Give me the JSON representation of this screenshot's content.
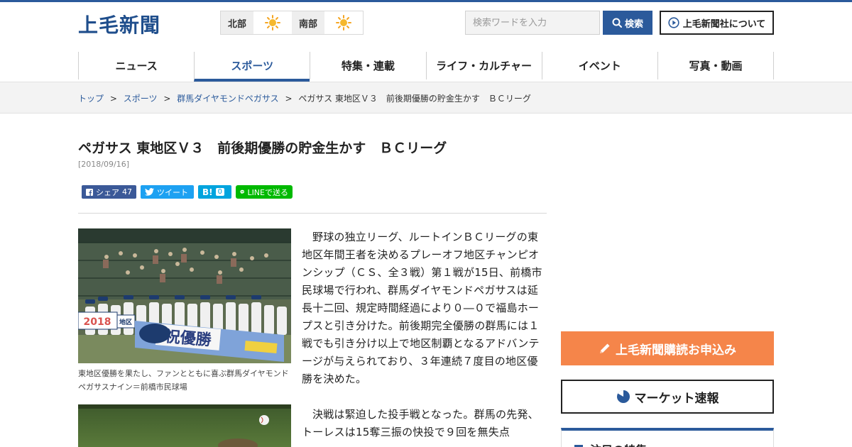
{
  "header": {
    "logo_text": "上毛新聞",
    "weather": [
      {
        "region": "北部",
        "icon": "sun-icon"
      },
      {
        "region": "南部",
        "icon": "sun-icon"
      }
    ],
    "search_placeholder": "検索ワードを入力",
    "search_label": "検索",
    "about_label": "上毛新聞社について"
  },
  "nav": {
    "items": [
      "ニュース",
      "スポーツ",
      "特集・連載",
      "ライフ・カルチャー",
      "イベント",
      "写真・動画"
    ],
    "active_index": 1
  },
  "breadcrumb": {
    "items": [
      "トップ",
      "スポーツ",
      "群馬ダイヤモンドペガサス"
    ],
    "current": "ペガサス 東地区Ｖ３　前後期優勝の貯金生かす　ＢＣリーグ",
    "separator": ">"
  },
  "article": {
    "title": "ペガサス 東地区Ｖ３　前後期優勝の貯金生かす　ＢＣリーグ",
    "date": "[2018/09/16]",
    "share": {
      "facebook_label": "シェア",
      "facebook_count": "47",
      "twitter_label": "ツイート",
      "hatena_label": "B!",
      "hatena_count": "0",
      "line_label": "LINEで送る"
    },
    "photo1_caption": "東地区優勝を果たし、ファンとともに喜ぶ群馬ダイヤモンドペガサスナイン＝前橋市民球場",
    "photo1_banner_text": "祝優勝",
    "photo1_year_text": "2018",
    "photo1_banner_small": "地区",
    "paragraph1": "野球の独立リーグ、ルートインＢＣリーグの東地区年間王者を決めるプレーオフ地区チャンピオンシップ（ＣＳ、全３戦）第１戦が15日、前橋市民球場で行われ、群馬ダイヤモンドペガサスは延長十二回、規定時間経過により０―０で福島ホープスと引き分けた。前後期完全優勝の群馬には１戦でも引き分け以上で地区制覇となるアドバンテージが与えられており、３年連続７度目の地区優勝を決めた。",
    "paragraph2": "決戦は緊迫した投手戦となった。群馬の先発、トーレスは15奪三振の快投で９回を無失点"
  },
  "sidebar": {
    "subscribe_label": "上毛新聞購読お申込み",
    "market_label": "マーケット速報",
    "feature_title": "注目の特集"
  },
  "colors": {
    "brand_blue": "#2b5a9b",
    "subscribe_orange": "#f5854a",
    "facebook": "#3b5998",
    "twitter": "#1da1f2",
    "hatena": "#00a4de",
    "line": "#00b900"
  }
}
